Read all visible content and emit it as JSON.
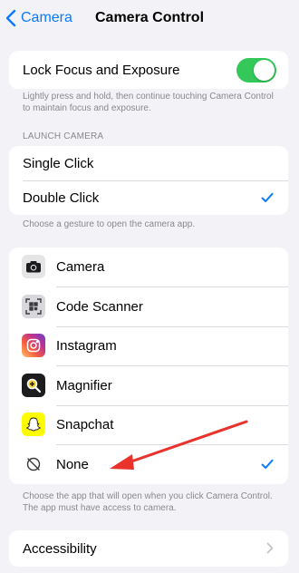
{
  "nav": {
    "back_label": "Camera",
    "title": "Camera Control"
  },
  "lock": {
    "label": "Lock Focus and Exposure",
    "enabled": true,
    "footer": "Lightly press and hold, then continue touching Camera Control to maintain focus and exposure."
  },
  "launch": {
    "header": "LAUNCH CAMERA",
    "options": [
      {
        "label": "Single Click",
        "selected": false
      },
      {
        "label": "Double Click",
        "selected": true
      }
    ],
    "footer": "Choose a gesture to open the camera app."
  },
  "apps": {
    "items": [
      {
        "label": "Camera",
        "icon": "camera-icon",
        "selected": false
      },
      {
        "label": "Code Scanner",
        "icon": "qr-scanner-icon",
        "selected": false
      },
      {
        "label": "Instagram",
        "icon": "instagram-icon",
        "selected": false
      },
      {
        "label": "Magnifier",
        "icon": "magnifier-icon",
        "selected": false
      },
      {
        "label": "Snapchat",
        "icon": "snapchat-icon",
        "selected": false
      },
      {
        "label": "None",
        "icon": "none-icon",
        "selected": true
      }
    ],
    "footer": "Choose the app that will open when you click Camera Control. The app must have access to camera."
  },
  "accessibility": {
    "label": "Accessibility"
  },
  "colors": {
    "accent": "#0a7aff",
    "toggle_on": "#34c759",
    "annotation_arrow": "#e8322b",
    "background": "#f2f2f7"
  }
}
